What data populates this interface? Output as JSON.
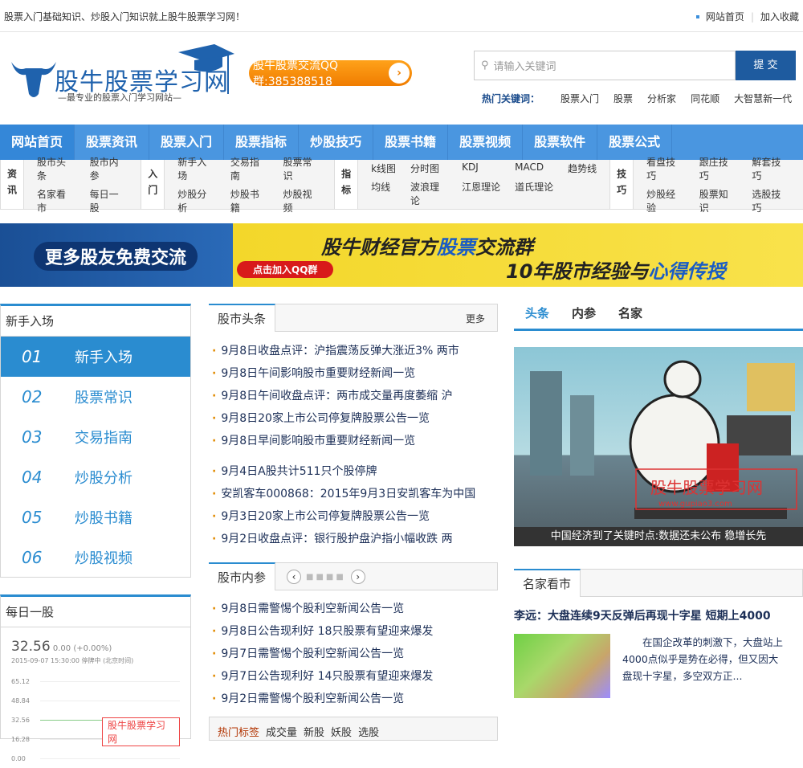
{
  "topbar": {
    "tagline": "股票入门基础知识、炒股入门知识就上股牛股票学习网！",
    "links": [
      "网站首页",
      "加入收藏"
    ]
  },
  "logo": {
    "name": "股牛股票学习网",
    "slogan": "—最专业的股票入门学习网站—"
  },
  "qq_button": {
    "label": "股牛股票交流QQ群:385388518"
  },
  "search": {
    "placeholder": "请输入关键词",
    "submit": "提 交"
  },
  "hot_keywords": {
    "label": "热门关键词：",
    "items": [
      "股票入门",
      "股票",
      "分析家",
      "同花顺",
      "大智慧新一代"
    ]
  },
  "nav": [
    "网站首页",
    "股票资讯",
    "股票入门",
    "股票指标",
    "炒股技巧",
    "股票书籍",
    "股票视频",
    "股票软件",
    "股票公式"
  ],
  "subnav": [
    {
      "cat": "资讯",
      "cols": 2,
      "links": [
        "股市头条",
        "股市内参",
        "名家看市",
        "每日一股"
      ]
    },
    {
      "cat": "入门",
      "cols": 3,
      "links": [
        "新手入场",
        "交易指南",
        "股票常识",
        "炒股分析",
        "炒股书籍",
        "炒股视频"
      ]
    },
    {
      "cat": "指标",
      "cols": 5,
      "links": [
        "k线图",
        "分时图",
        "KDJ",
        "MACD",
        "趋势线",
        "均线",
        "波浪理论",
        "江恩理论",
        "道氏理论"
      ]
    },
    {
      "cat": "技巧",
      "cols": 3,
      "links": [
        "看盘技巧",
        "跟庄技巧",
        "解套技巧",
        "炒股经验",
        "股票知识",
        "选股技巧"
      ]
    }
  ],
  "banner": {
    "left": "更多股友免费交流",
    "button": "点击加入QQ群",
    "line1a": "股牛财经官方",
    "line1b": "股票",
    "line1c": "交流群",
    "line2a": "10年股市经验与",
    "line2b": "心得传授"
  },
  "left_menu": {
    "title": "新手入场",
    "items": [
      {
        "n": "01",
        "label": "新手入场"
      },
      {
        "n": "02",
        "label": "股票常识"
      },
      {
        "n": "03",
        "label": "交易指南"
      },
      {
        "n": "04",
        "label": "炒股分析"
      },
      {
        "n": "05",
        "label": "炒股书籍"
      },
      {
        "n": "06",
        "label": "炒股视频"
      }
    ]
  },
  "daily_stock": {
    "title": "每日一股",
    "price": "32.56",
    "change": "0.00",
    "pct": "(+0.00%)",
    "time": "2015-09-07 15:30:00",
    "status": "停牌中",
    "tz": "(北京时间)",
    "ticks": [
      "65.12",
      "48.84",
      "32.56",
      "16.28",
      "0.00"
    ],
    "watermark": "股牛股票学习网"
  },
  "headlines": {
    "title": "股市头条",
    "more": "更多",
    "items": [
      "9月8日收盘点评：沪指震荡反弹大涨近3% 两市",
      "9月8日午间影响股市重要财经新闻一览",
      "9月8日午间收盘点评：两市成交量再度萎缩 沪",
      "9月8日20家上市公司停复牌股票公告一览",
      "9月8日早间影响股市重要财经新闻一览"
    ],
    "items2": [
      "9月4日A股共计511只个股停牌",
      "安凯客车000868：2015年9月3日安凯客车为中国",
      "9月3日20家上市公司停复牌股票公告一览",
      "9月2日收盘点评：银行股护盘沪指小幅收跌 两"
    ]
  },
  "neican": {
    "title": "股市内参",
    "items": [
      "9月8日需警惕个股利空新闻公告一览",
      "9月8日公告现利好 18只股票有望迎来爆发",
      "9月7日需警惕个股利空新闻公告一览",
      "9月7日公告现利好 14只股票有望迎来爆发",
      "9月2日需警惕个股利空新闻公告一览"
    ]
  },
  "hot_tags": {
    "label": "热门标签",
    "items": [
      "成交量",
      "新股",
      "妖股",
      "选股"
    ]
  },
  "right_tabs": [
    "头条",
    "内参",
    "名家"
  ],
  "feature": {
    "caption": "中国经济到了关键时点:数据还未公布 稳增长先",
    "watermark": "股牛股票学习网",
    "watermark_url": "www.gupiao3.com"
  },
  "mingjia": {
    "title": "名家看市",
    "headline": "李远：大盘连续9天反弹后再现十字星 短期上4000",
    "summary": "在国企改革的刺激下，大盘站上4000点似乎是势在必得，但又因大盘现十字星，多空双方正..."
  }
}
